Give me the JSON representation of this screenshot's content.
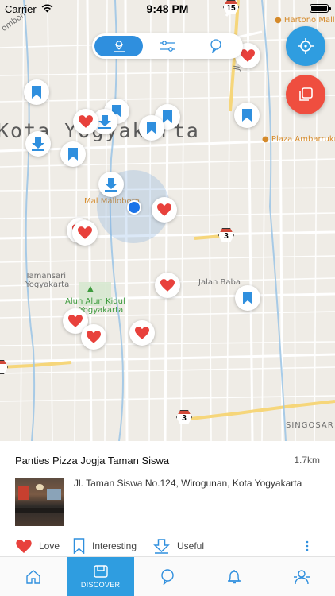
{
  "status_bar": {
    "carrier": "Carrier",
    "time": "9:48 PM",
    "icons": [
      "wifi-icon",
      "battery-icon"
    ]
  },
  "map": {
    "city_label": "Kota Yogyakarta",
    "labels": {
      "hartono_mall": "Hartono Mall",
      "plaza_ambarrukmo": "Plaza Ambarrukmo",
      "mal_malioboro": "Mal Malioboro",
      "tamansari_line1": "Tamansari",
      "tamansari_line2": "Yogyakarta",
      "alun_line1": "Alun Alun Kidul",
      "alun_line2": "Yogyakarta",
      "jalan_baba": "Jalan Baba",
      "singosari": "SINGOSAR",
      "jombon": "ombon",
      "jalan_vertical": "Jl",
      "route_15": "15",
      "route_3a": "3",
      "route_3b": "3"
    },
    "pin_types": [
      "bookmark",
      "heart",
      "download"
    ]
  },
  "segment": {
    "options": [
      "map-pin-icon",
      "filter-sliders-icon",
      "bubble-icon"
    ],
    "selected": "map-pin-icon"
  },
  "place": {
    "name": "Panties Pizza Jogja Taman Siswa",
    "distance": "1.7km",
    "address": "Jl. Taman Siswa No.124, Wirogunan, Kota Yogyakarta"
  },
  "actions": {
    "love": "Love",
    "interesting": "Interesting",
    "useful": "Useful"
  },
  "tabbar": {
    "discover": "DISCOVER",
    "tabs": [
      "home-icon",
      "discover-icon",
      "bubble-icon",
      "bell-icon",
      "profile-icon"
    ],
    "active": "discover"
  },
  "colors": {
    "accent_blue": "#2f9de0",
    "accent_red": "#ef4e3f",
    "heart_red": "#e8413c",
    "pin_blue": "#2f8fde",
    "map_bg": "#efece6"
  }
}
